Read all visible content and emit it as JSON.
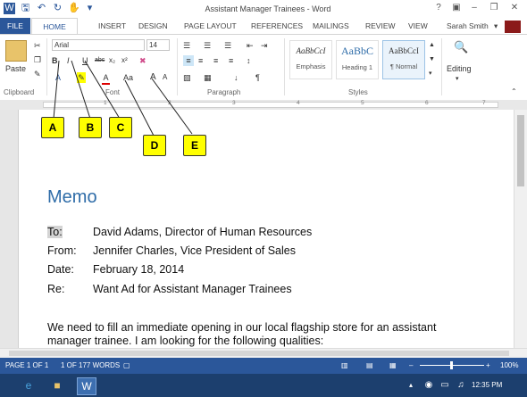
{
  "window": {
    "title": "Assistant Manager Trainees - Word",
    "help": "?",
    "user": "Sarah Smith"
  },
  "tabs": [
    "FILE",
    "HOME",
    "INSERT",
    "DESIGN",
    "PAGE LAYOUT",
    "REFERENCES",
    "MAILINGS",
    "REVIEW",
    "VIEW"
  ],
  "ribbon": {
    "clipboard": {
      "label": "Clipboard",
      "paste": "Paste"
    },
    "font": {
      "label": "Font",
      "font_name": "Arial",
      "font_size": "14",
      "bold": "B",
      "italic": "I",
      "underline": "U",
      "strike": "abc",
      "subscript": "x₂",
      "superscript": "x²",
      "change_case": "Aa",
      "grow": "A",
      "shrink": "A"
    },
    "paragraph": {
      "label": "Paragraph"
    },
    "styles": {
      "label": "Styles",
      "items": [
        {
          "sample": "AaBbCcI",
          "name": "Emphasis"
        },
        {
          "sample": "AaBbC",
          "name": "Heading 1"
        },
        {
          "sample": "AaBbCcI",
          "name": "¶ Normal"
        }
      ]
    },
    "editing": {
      "label": "Editing"
    }
  },
  "ruler": {
    "numbers": [
      "1",
      "2",
      "3",
      "4",
      "5",
      "6",
      "7"
    ]
  },
  "callouts": [
    "A",
    "B",
    "C",
    "D",
    "E"
  ],
  "document": {
    "title": "Memo",
    "fields": [
      {
        "label": "To:",
        "value": "David Adams, Director of Human Resources"
      },
      {
        "label": "From:",
        "value": "Jennifer Charles, Vice President of Sales"
      },
      {
        "label": "Date:",
        "value": "February 18, 2014"
      },
      {
        "label": "Re:",
        "value": "Want Ad for Assistant Manager Trainees"
      }
    ],
    "body": "We need to fill an immediate opening in our local flagship store for an assistant manager trainee. I am looking for the following qualities:"
  },
  "status": {
    "page": "PAGE 1 OF 1",
    "words": "1 OF 177 WORDS",
    "zoom": "100%"
  },
  "taskbar": {
    "time": "12:35 PM"
  },
  "colors": {
    "accent": "#2b579a",
    "title_blue": "#2e6ca8",
    "callout": "#ffff00"
  }
}
